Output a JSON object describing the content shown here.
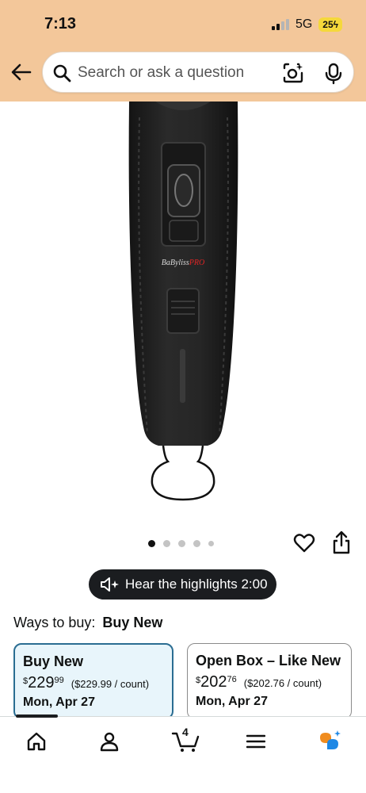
{
  "status_bar": {
    "time": "7:13",
    "network": "5G",
    "battery": "25"
  },
  "search": {
    "placeholder": "Search or ask a question"
  },
  "product": {
    "brand_logo_text": "BaByliss",
    "brand_logo_suffix": "PRO",
    "image_count": 5,
    "active_image_index": 0
  },
  "highlights": {
    "label": "Hear the highlights 2:00"
  },
  "ways_to_buy": {
    "prefix": "Ways to buy:",
    "selected": "Buy New",
    "options": [
      {
        "title": "Buy New",
        "currency": "$",
        "price_whole": "229",
        "price_cents": "99",
        "unit_price": "($229.99 / count)",
        "delivery": "Mon, Apr 27",
        "selected": true
      },
      {
        "title": "Open Box – Like New",
        "currency": "$",
        "price_whole": "202",
        "price_cents": "76",
        "unit_price": "($202.76 / count)",
        "delivery": "Mon, Apr 27",
        "selected": false
      }
    ]
  },
  "bottom_nav": {
    "cart_count": "4",
    "items": [
      "home-icon",
      "account-icon",
      "cart-icon",
      "menu-icon",
      "rufus-icon"
    ]
  },
  "colors": {
    "header_bg": "#f3c79a",
    "selected_card_bg": "#e8f5fb",
    "selected_card_border": "#2a6d92",
    "pill_bg": "#1b1d20"
  }
}
